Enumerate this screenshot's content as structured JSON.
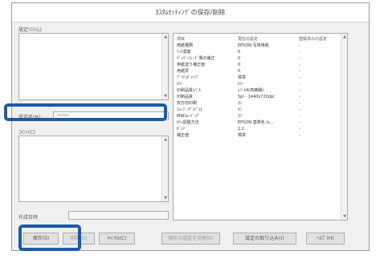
{
  "dialog": {
    "title": "ｶｽﾀﾑｾｯﾃｨﾝｸﾞの保存/削除"
  },
  "left": {
    "list_label": "設定ﾘｽﾄ(L)",
    "name_label": "設定名(N):",
    "name_value": "xxxxx",
    "comment_label": "ｺﾒﾝﾄ(C)",
    "date_label": "作成日時"
  },
  "settings_table": {
    "headers": [
      "項目",
      "現在の設定",
      "登録済みの設定"
    ],
    "rows": [
      [
        "用紙種類",
        "EPSON 写真用紙",
        "-"
      ],
      [
        "ｲﾝｸ濃度",
        "0",
        "-"
      ],
      [
        "ﾍﾟｰﾊﾟｰﾌｨｰﾄﾞ量の補正",
        "0",
        "-"
      ],
      [
        "用紙送り補正値",
        "0",
        "-"
      ],
      [
        "用紙厚",
        "0",
        "-"
      ],
      [
        "ﾌﾟﾗﾃﾝｷﾞｬｯﾌﾟ",
        "標準",
        "-"
      ],
      [
        "ｶﾗｰ",
        "ｶﾗｰ",
        "-"
      ],
      [
        "印刷品質ﾚﾍﾞﾙ",
        "ﾚﾍﾞﾙ4(高精細)",
        "-"
      ],
      [
        "印刷品質",
        "5pl - 1440x720dpi",
        "-"
      ],
      [
        "双方向印刷",
        "ｵﾝ",
        "-"
      ],
      [
        "ｽﾑｰｼﾞﾝｸﾞ(ﾊﾟｽ)",
        "ｵﾌ",
        "-"
      ],
      [
        "MWｽﾑｰｼﾞﾝｸﾞ",
        "ｵﾌ",
        "-"
      ],
      [
        "ｶﾗｰ調整方法",
        "EPSON 基準色 (s...",
        "-"
      ],
      [
        "ｶﾞﾝﾏ",
        "2.2",
        "-"
      ],
      [
        "補正値",
        "標準",
        "-"
      ]
    ]
  },
  "buttons": {
    "save": "保存(S)",
    "delete": "削除(D)",
    "cancel": "ｷｬﾝｾﾙ(C)",
    "load_current": "現在の設定を反映(R)",
    "apply_settings": "設定の取り込み(I)",
    "help": "ﾍﾙﾌﾟ(H)"
  },
  "highlight_color": "#1b5aa8"
}
